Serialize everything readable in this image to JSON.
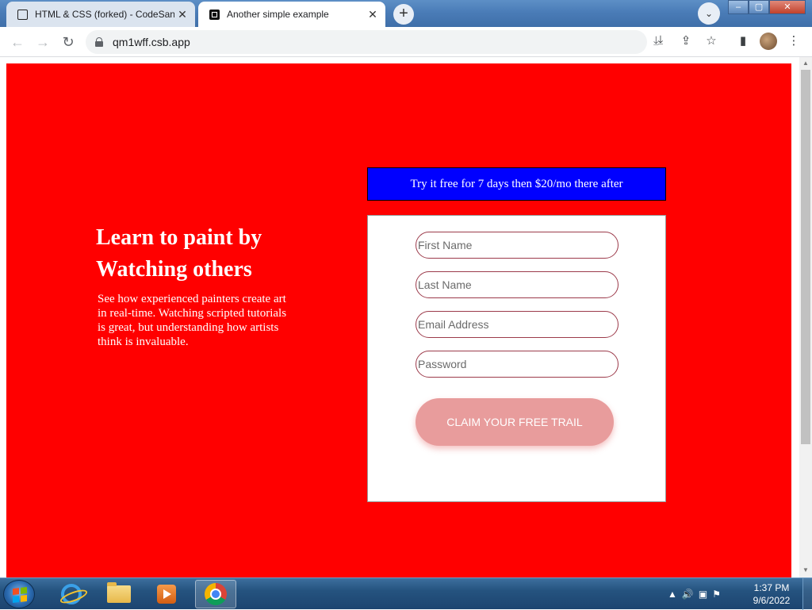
{
  "browser": {
    "tabs": [
      {
        "title": "HTML & CSS (forked) - CodeSand",
        "close": "✕"
      },
      {
        "title": "Another simple example",
        "close": "✕"
      }
    ],
    "new_tab": "+",
    "tab_search": "⌄",
    "window_buttons": {
      "minimize": "–",
      "maximize": "▢",
      "close": "✕"
    },
    "url": "qm1wff.csb.app",
    "nav": {
      "back": "←",
      "forward": "→",
      "reload": "↻"
    }
  },
  "page": {
    "hero": {
      "heading": "Learn to paint by Watching others",
      "description": "See how experienced painters create art in real-time. Watching scripted tutorials is great, but understanding how artists think is invaluable."
    },
    "promo": "Try it free for 7 days then $20/mo there after",
    "form": {
      "first_name_placeholder": "First Name",
      "last_name_placeholder": "Last Name",
      "email_placeholder": "Email Address",
      "password_placeholder": "Password",
      "submit_label": "CLAIM YOUR FREE TRAIL"
    },
    "colors": {
      "background": "#ff0000",
      "promo": "#0000ff",
      "button": "#e89c9c"
    }
  },
  "taskbar": {
    "time": "1:37 PM",
    "date": "9/6/2022"
  }
}
